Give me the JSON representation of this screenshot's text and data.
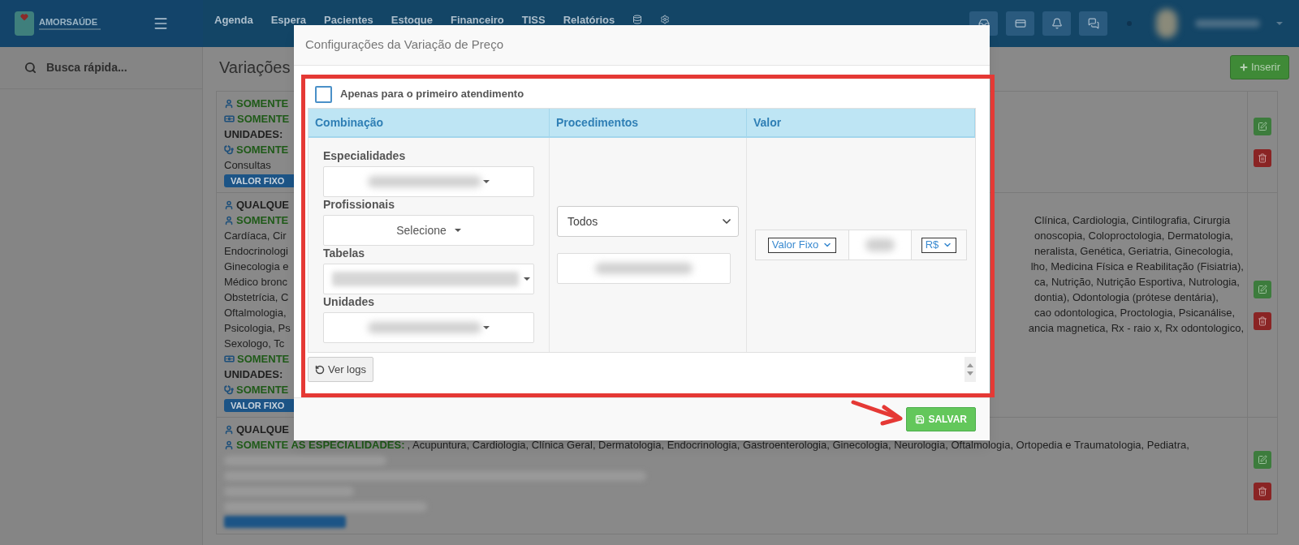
{
  "brand": {
    "name": "AMORSAÚDE"
  },
  "nav": {
    "items": [
      "Agenda",
      "Espera",
      "Pacientes",
      "Estoque",
      "Financeiro",
      "TISS",
      "Relatórios"
    ]
  },
  "sidebar": {
    "search": {
      "placeholder": "Busca rápida..."
    }
  },
  "page": {
    "title": "Variações",
    "insert_button": "Inserir"
  },
  "cards": [
    {
      "rows": [
        {
          "kind": "specialty_rule",
          "label": "SOMENTE"
        },
        {
          "kind": "price_rule",
          "label": "SOMENTE"
        },
        {
          "kind": "units",
          "label": "UNIDADES:"
        },
        {
          "kind": "procedure_rule",
          "label": "SOMENTE"
        },
        {
          "kind": "text",
          "text": "Consultas"
        },
        {
          "kind": "badge",
          "label": "VALOR FIXO"
        }
      ]
    },
    {
      "rows": [
        {
          "kind": "any_rule",
          "label": "QUALQUE"
        },
        {
          "kind": "specialty_rule",
          "label": "SOMENTE",
          "right": "Clínica, Cardiologia, Cintilografia, Cirurgia"
        },
        {
          "kind": "text",
          "text": "Cardíaca, Cir",
          "right": "onoscopia, Coloproctologia, Dermatologia,"
        },
        {
          "kind": "text",
          "text": "Endocrinologi",
          "right": "neralista, Genética, Geriatria, Ginecologia,"
        },
        {
          "kind": "text",
          "text": "Ginecologia e",
          "right": "lho, Medicina Física e Reabilitação (Fisiatria),"
        },
        {
          "kind": "text",
          "text": "Médico bronc",
          "right": "ca, Nutrição, Nutrição Esportiva, Nutrologia,"
        },
        {
          "kind": "text",
          "text": "Obstetrícia, C",
          "right": "dontia), Odontologia (prótese dentária),"
        },
        {
          "kind": "text",
          "text": "Oftalmologia,",
          "right": "cao odontologica, Proctologia, Psicanálise,"
        },
        {
          "kind": "text",
          "text": "Psicologia, Ps",
          "right": "ancia magnetica, Rx - raio x, Rx odontologico,"
        },
        {
          "kind": "text",
          "text": "Sexologo, Tc"
        },
        {
          "kind": "price_rule",
          "label": "SOMENTE"
        },
        {
          "kind": "units",
          "label": "UNIDADES:"
        },
        {
          "kind": "procedure_rule",
          "label": "SOMENTE"
        },
        {
          "kind": "badge",
          "label": "VALOR FIXO"
        }
      ]
    },
    {
      "rows": [
        {
          "kind": "any_rule",
          "label": "QUALQUE"
        },
        {
          "kind": "specialty_rule",
          "label": "SOMENTE AS ESPECIALIDADES:",
          "text": " , Acupuntura, Cardiologia, Clínica Geral, Dermatologia, Endocrinologia, Gastroenterologia, Ginecologia, Neurologia, Oftalmologia, Ortopedia e Traumatologia, Pediatra,"
        },
        {
          "kind": "redacted"
        },
        {
          "kind": "redacted"
        },
        {
          "kind": "redacted"
        },
        {
          "kind": "redacted"
        },
        {
          "kind": "redacted_badge"
        }
      ]
    }
  ],
  "modal": {
    "title": "Configurações da Variação de Preço",
    "first_visit_only": {
      "label": "Apenas para o primeiro atendimento",
      "checked": false
    },
    "columns": [
      "Combinação",
      "Procedimentos",
      "Valor"
    ],
    "combination_fields": [
      {
        "label": "Especialidades",
        "kind": "redacted"
      },
      {
        "label": "Profissionais",
        "kind": "select",
        "value": "Selecione"
      },
      {
        "label": "Tabelas",
        "kind": "redacted_wide"
      },
      {
        "label": "Unidades",
        "kind": "redacted"
      }
    ],
    "procedure_fields": [
      {
        "kind": "native_select",
        "value": "Todos"
      },
      {
        "kind": "redacted"
      }
    ],
    "value": {
      "type_select": "Valor Fixo",
      "currency_select": "R$"
    },
    "logs_button": "Ver logs",
    "save_button": "SALVAR"
  }
}
